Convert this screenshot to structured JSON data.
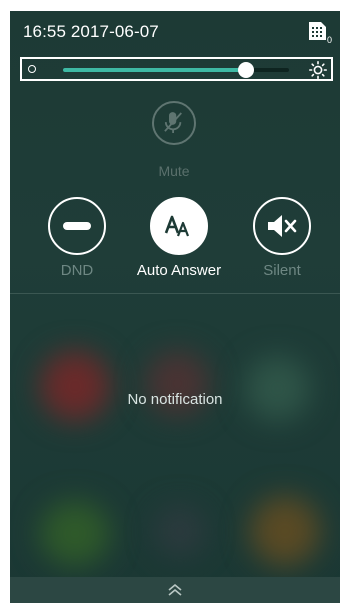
{
  "status": {
    "datetime": "16:55 2017-06-07",
    "sim_icon": "sim-card-icon",
    "sim_sub": "0"
  },
  "brightness": {
    "level": 0.81,
    "low_icon": "brightness-low-icon",
    "high_icon": "brightness-high-icon",
    "accent": "#3eb9a4"
  },
  "toggles": {
    "mute": {
      "label": "Mute",
      "icon": "mic-off-icon",
      "enabled": false
    },
    "dnd": {
      "label": "DND",
      "icon": "do-not-disturb-icon",
      "active": false
    },
    "auto_answer": {
      "label": "Auto Answer",
      "icon": "auto-answer-icon",
      "active": true
    },
    "silent": {
      "label": "Silent",
      "icon": "speaker-muted-icon",
      "active": false
    }
  },
  "notifications": {
    "empty_text": "No notification"
  },
  "footer": {
    "icon": "chevron-up-double-icon"
  }
}
